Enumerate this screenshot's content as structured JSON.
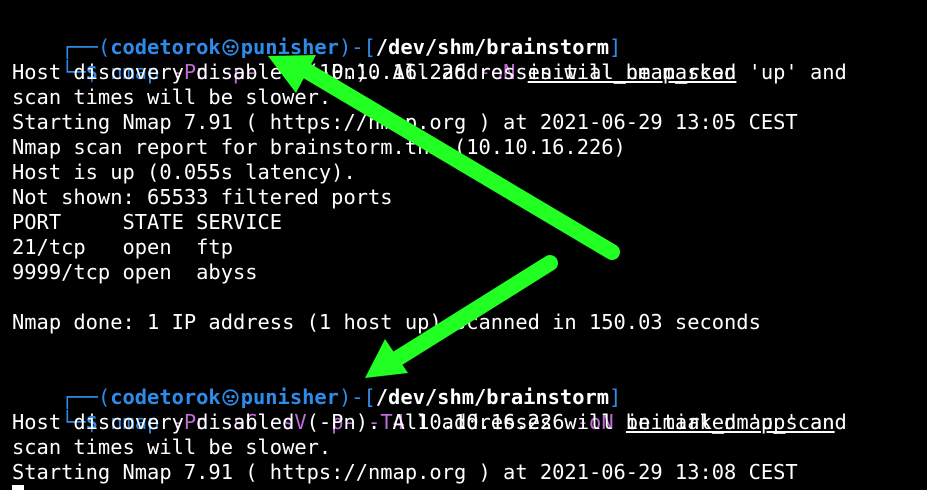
{
  "prompts": [
    {
      "box_top": "┌──(",
      "user": "codetorok",
      "host": "punisher",
      "dir_open": ")-[",
      "path": "/dev/shm/brainstorm",
      "dir_close": "]",
      "box_bottom": "└─",
      "dollar": "$",
      "cmd": "nmap",
      "flags": "-Pn -p- -T4",
      "ip": "10.10.16.226",
      "out_flag": "-oN",
      "outfile": "initial_nmap_scan"
    },
    {
      "box_top": "┌──(",
      "user": "codetorok",
      "host": "punisher",
      "dir_open": ")-[",
      "path": "/dev/shm/brainstorm",
      "dir_close": "]",
      "box_bottom": "└─",
      "dollar": "$",
      "cmd": "nmap",
      "flags": "-Pn -sC -sV -p- -T4",
      "ip": "10.10.16.226",
      "out_flag": "-oN",
      "outfile": "initial_nmap_scan"
    }
  ],
  "output1": [
    "Host discovery disabled (-Pn). All addresses will be marked 'up' and",
    "scan times will be slower.",
    "Starting Nmap 7.91 ( https://nmap.org ) at 2021-06-29 13:05 CEST",
    "Nmap scan report for brainstorm.thm (10.10.16.226)",
    "Host is up (0.055s latency).",
    "Not shown: 65533 filtered ports",
    "PORT     STATE SERVICE",
    "21/tcp   open  ftp",
    "9999/tcp open  abyss",
    "Nmap done: 1 IP address (1 host up) scanned in 150.03 seconds"
  ],
  "output2": [
    "Host discovery disabled (-Pn). All addresses will be marked 'up' and",
    "scan times will be slower.",
    "Starting Nmap 7.91 ( https://nmap.org ) at 2021-06-29 13:08 CEST"
  ],
  "colors": {
    "background": "#000000",
    "text": "#ffffff",
    "prompt_blue": "#2f8bea",
    "flag_purple": "#c36bd8",
    "annotation_arrow": "#22ff22"
  },
  "icons": {
    "user_host_separator": "skull-icon",
    "annotation": "arrow-icon"
  }
}
